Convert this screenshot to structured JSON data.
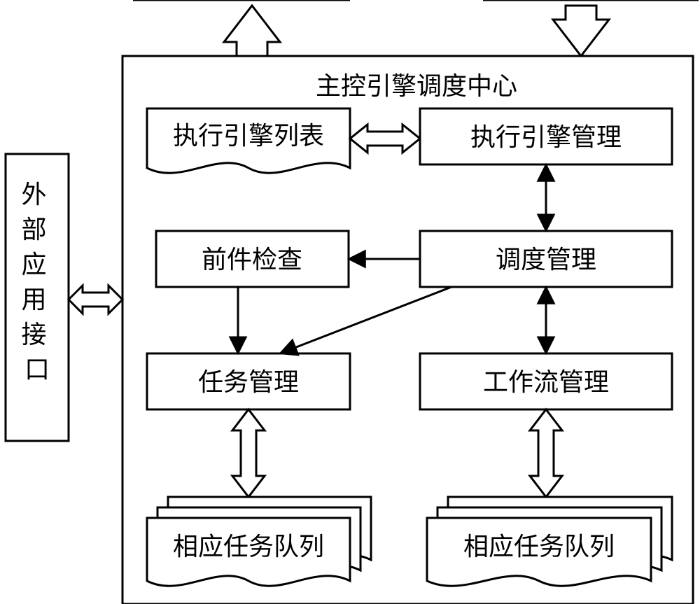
{
  "diagram": {
    "title": "主控引擎调度中心",
    "external_interface": "外部应用接口",
    "exec_engine_list": "执行引擎列表",
    "exec_engine_mgmt": "执行引擎管理",
    "precondition_check": "前件检查",
    "schedule_mgmt": "调度管理",
    "task_mgmt": "任务管理",
    "workflow_mgmt": "工作流管理",
    "task_queue_left": "相应任务队列",
    "task_queue_right": "相应任务队列"
  }
}
